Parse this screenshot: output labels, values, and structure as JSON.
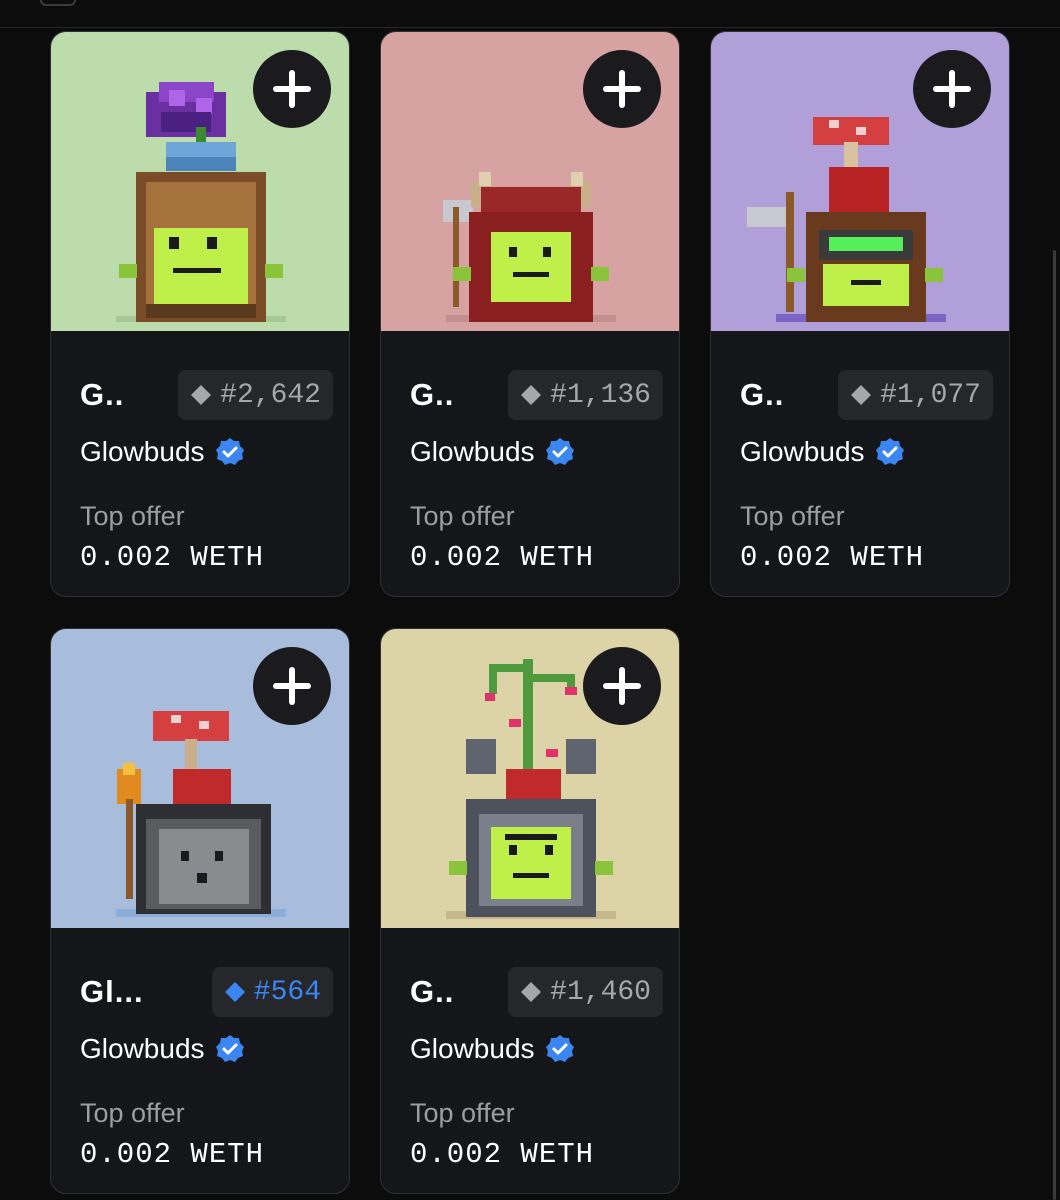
{
  "colors": {
    "page_bg": "#0c0c0d",
    "card_bg": "#151619",
    "verified_blue": "#3b86f3",
    "rarity_blue": "#3b86f3"
  },
  "icons": {
    "add": "plus-icon",
    "rarity": "diamond-icon",
    "verified": "verified-badge-icon"
  },
  "cards": [
    {
      "name": "G..",
      "rank": "#2,642",
      "rank_style": "gray",
      "collection": "Glowbuds",
      "offer_label": "Top offer",
      "offer_value": "0.002 WETH",
      "bg": "#bcdcab",
      "art": "purple-flower-backpack"
    },
    {
      "name": "G..",
      "rank": "#1,136",
      "rank_style": "gray",
      "collection": "Glowbuds",
      "offer_label": "Top offer",
      "offer_value": "0.002 WETH",
      "bg": "#d6a2a2",
      "art": "viking-helmet-axe"
    },
    {
      "name": "G..",
      "rank": "#1,077",
      "rank_style": "gray",
      "collection": "Glowbuds",
      "offer_label": "Top offer",
      "offer_value": "0.002 WETH",
      "bg": "#b19fd9",
      "art": "mushroom-goggles-pickaxe"
    },
    {
      "name": "Gl...",
      "rank": "#564",
      "rank_style": "blue",
      "collection": "Glowbuds",
      "offer_label": "Top offer",
      "offer_value": "0.002 WETH",
      "bg": "#a8bcdc",
      "art": "mushroom-stone-torch"
    },
    {
      "name": "G..",
      "rank": "#1,460",
      "rank_style": "gray",
      "collection": "Glowbuds",
      "offer_label": "Top offer",
      "offer_value": "0.002 WETH",
      "bg": "#dcd3a6",
      "art": "bamboo-robot"
    }
  ]
}
